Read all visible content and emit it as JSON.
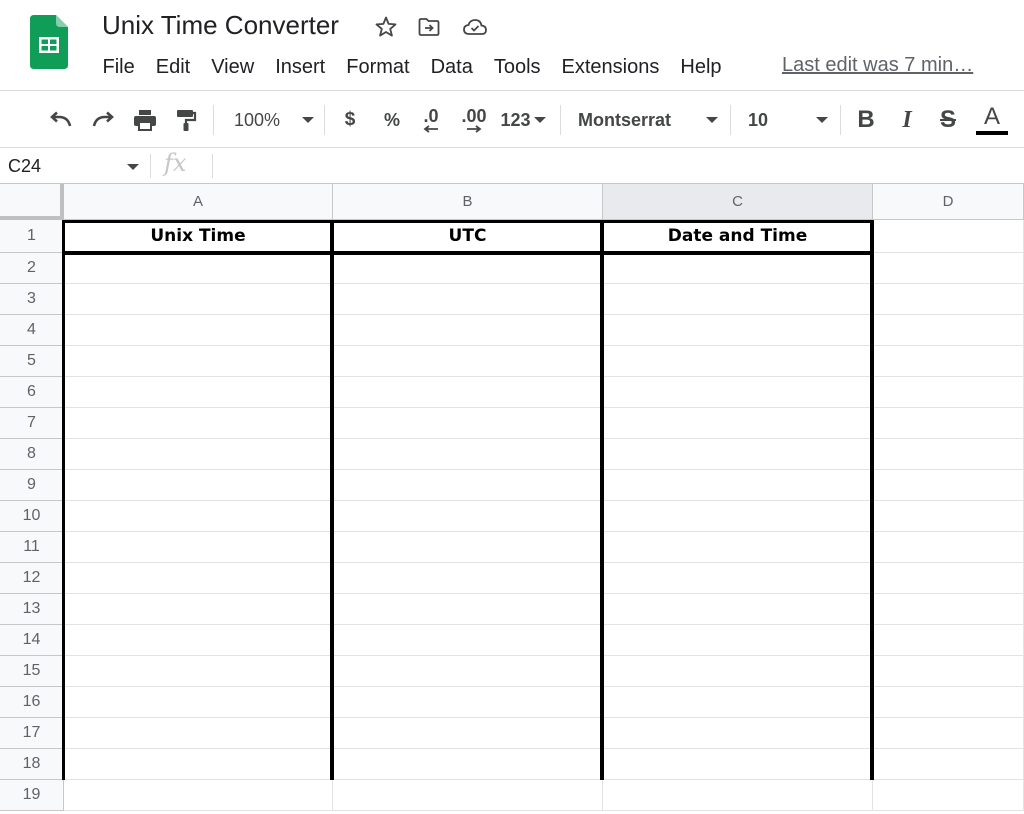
{
  "app": {
    "doc_title": "Unix Time Converter",
    "last_edit": "Last edit was 7 min…",
    "menu": [
      "File",
      "Edit",
      "View",
      "Insert",
      "Format",
      "Data",
      "Tools",
      "Extensions",
      "Help"
    ]
  },
  "toolbar": {
    "zoom": "100%",
    "currency": "$",
    "percent": "%",
    "decrease_decimal": ".0",
    "increase_decimal": ".00",
    "more_formats": "123",
    "font": "Montserrat",
    "font_size": "10",
    "bold": "B",
    "italic": "I",
    "strikethrough": "S",
    "text_color": "A",
    "text_color_value": "#000000"
  },
  "formula_bar": {
    "name_box": "C24",
    "fx": "fx",
    "formula": ""
  },
  "sheet": {
    "columns": [
      "A",
      "B",
      "C",
      "D"
    ],
    "selected_column": "C",
    "rows": [
      "1",
      "2",
      "3",
      "4",
      "5",
      "6",
      "7",
      "8",
      "9",
      "10",
      "11",
      "12",
      "13",
      "14",
      "15",
      "16",
      "17",
      "18",
      "19"
    ],
    "headers": [
      "Unix Time",
      "UTC",
      "Date and Time"
    ]
  },
  "colors": {
    "brand_green": "#0F9D58",
    "header_bg": "#F8F9FA",
    "grid_line": "#E2E3E3",
    "table_border": "#000000"
  }
}
